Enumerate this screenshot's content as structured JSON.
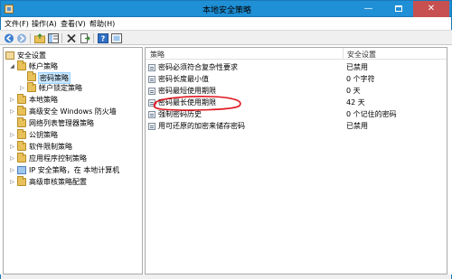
{
  "window": {
    "title": "本地安全策略",
    "minimize": "—",
    "close": "✕"
  },
  "menu": {
    "items": [
      "文件(F)",
      "操作(A)",
      "查看(V)",
      "帮助(H)"
    ]
  },
  "toolbar": {
    "icons": [
      "back-arrow-icon",
      "forward-arrow-icon",
      "up-folder-icon",
      "show-tree-icon",
      "delete-icon",
      "export-icon",
      "help-icon",
      "properties-icon"
    ]
  },
  "tree": {
    "root": "安全设置",
    "items": [
      {
        "label": "帐户策略",
        "level": 1,
        "expanded": true
      },
      {
        "label": "密码策略",
        "level": 2,
        "selected": true
      },
      {
        "label": "帐户锁定策略",
        "level": 2
      },
      {
        "label": "本地策略",
        "level": 1
      },
      {
        "label": "高级安全 Windows 防火墙",
        "level": 1
      },
      {
        "label": "网络列表管理器策略",
        "level": 1
      },
      {
        "label": "公钥策略",
        "level": 1
      },
      {
        "label": "软件限制策略",
        "level": 1
      },
      {
        "label": "应用程序控制策略",
        "level": 1
      },
      {
        "label": "IP 安全策略，在 本地计算机",
        "level": 1
      },
      {
        "label": "高级审核策略配置",
        "level": 1
      }
    ]
  },
  "list": {
    "columns": [
      "策略",
      "安全设置"
    ],
    "rows": [
      {
        "policy": "密码必须符合复杂性要求",
        "setting": "已禁用"
      },
      {
        "policy": "密码长度最小值",
        "setting": "0 个字符"
      },
      {
        "policy": "密码最短使用期限",
        "setting": "0 天"
      },
      {
        "policy": "密码最长使用期限",
        "setting": "42 天"
      },
      {
        "policy": "强制密码历史",
        "setting": "0 个记住的密码"
      },
      {
        "policy": "用可还原的加密来储存密码",
        "setting": "已禁用"
      }
    ]
  },
  "colors": {
    "title_bar": "#1f8fd6",
    "selection": "#cce8ff",
    "annotation": "#e0141e"
  }
}
